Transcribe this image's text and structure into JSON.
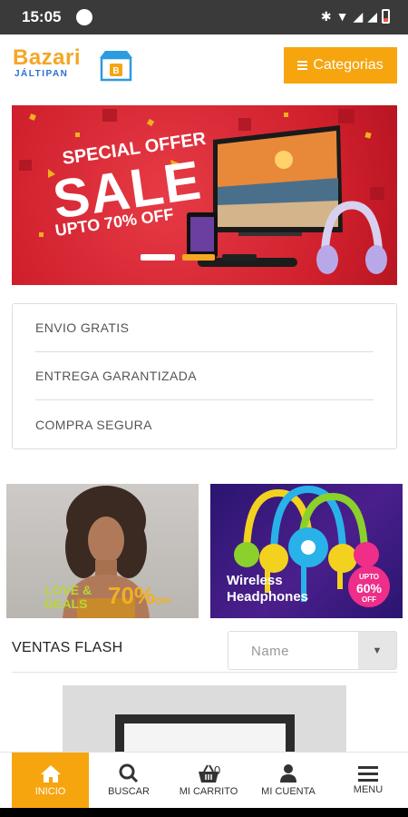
{
  "status": {
    "time": "15:05"
  },
  "header": {
    "brand": "Bazari",
    "city": "JÁLTIPAN",
    "categories_label": "Categorias"
  },
  "hero": {
    "line1": "SPECIAL OFFER",
    "line2": "SALE",
    "line3": "UPTO 70% OFF"
  },
  "features": [
    "ENVIO GRATIS",
    "ENTREGA GARANTIZADA",
    "COMPRA SEGURA"
  ],
  "promos": {
    "left": {
      "line_a": "LOVE &",
      "line_b": "DEALS",
      "discount": "70%",
      "suffix": "OFF"
    },
    "right": {
      "title_a": "Wireless",
      "title_b": "Headphones",
      "badge_top": "UPTO",
      "badge_value": "60%",
      "badge_bottom": "OFF"
    }
  },
  "flash": {
    "title": "VENTAS FLASH",
    "sort_value": "Name"
  },
  "bottom_nav": {
    "items": [
      {
        "label": "INICIO",
        "icon": "home-icon"
      },
      {
        "label": "BUSCAR",
        "icon": "search-icon"
      },
      {
        "label": "MI CARRITO",
        "icon": "basket-icon",
        "count": "0"
      },
      {
        "label": "MI CUENTA",
        "icon": "user-icon"
      },
      {
        "label": "MENU",
        "icon": "menu-icon"
      }
    ]
  },
  "colors": {
    "accent": "#f6a50f",
    "brand_blue": "#2d6ed0",
    "banner_red": "#cf1f2c"
  }
}
